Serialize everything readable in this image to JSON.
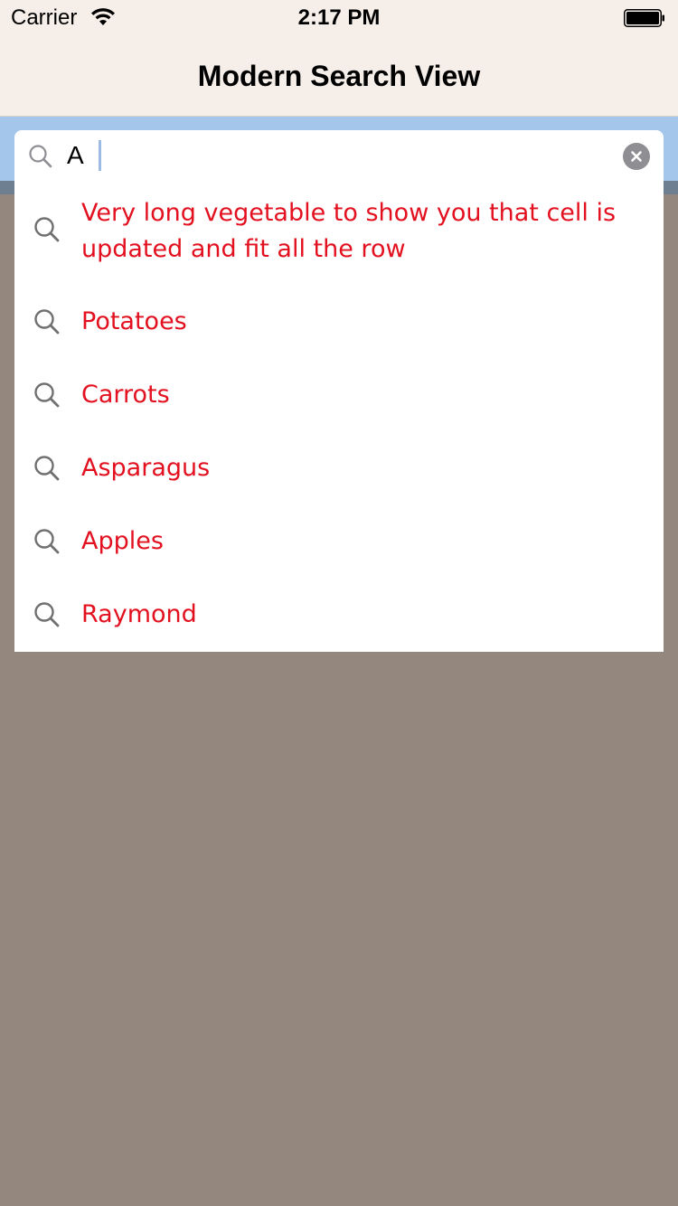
{
  "status_bar": {
    "carrier": "Carrier",
    "time": "2:17 PM",
    "wifi_icon": "wifi-icon",
    "battery_icon": "battery-icon",
    "battery_level": 1.0
  },
  "nav": {
    "title": "Modern Search View"
  },
  "search": {
    "value": "A",
    "search_icon": "search-icon",
    "clear_icon": "clear-icon"
  },
  "results": [
    {
      "label": "Very long vegetable to show you that cell is updated and fit all the row",
      "icon": "search-icon"
    },
    {
      "label": "Potatoes",
      "icon": "search-icon"
    },
    {
      "label": "Carrots",
      "icon": "search-icon"
    },
    {
      "label": "Asparagus",
      "icon": "search-icon"
    },
    {
      "label": "Apples",
      "icon": "search-icon"
    },
    {
      "label": "Raymond",
      "icon": "search-icon"
    }
  ],
  "colors": {
    "result_text": "#e3101f",
    "background": "#93877e",
    "search_strip": "#a3c6ea",
    "nav_background": "#f6eee9"
  }
}
